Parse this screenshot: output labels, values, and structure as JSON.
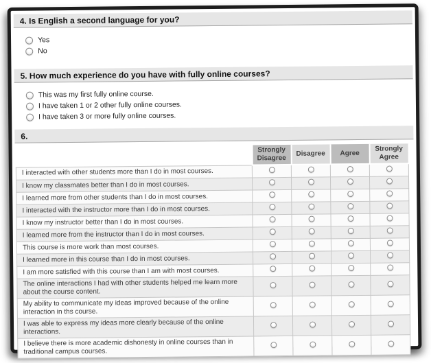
{
  "questions": [
    {
      "id": "q4",
      "title": "4. Is English a second language for you?",
      "options": [
        "Yes",
        "No"
      ],
      "selected": null
    },
    {
      "id": "q5",
      "title": "5. How much experience do you have with fully online courses?",
      "options": [
        "This was my first fully online course.",
        "I have taken 1 or 2 other fully online courses.",
        "I have taken 3 or more fully online courses."
      ],
      "selected": null
    },
    {
      "id": "q6",
      "title": "6.",
      "table": {
        "columns": [
          "Strongly Disagree",
          "Disagree",
          "Agree",
          "Strongly Agree"
        ],
        "rows": [
          "I interacted with other students more than I do in most courses.",
          "I know my classmates better than I do in most courses.",
          "I learned more from other students than I do in most courses.",
          "I interacted with the instructor more than I do in most courses.",
          "I know my instructor better than I do in most courses.",
          "I learned more from the instructor than I do in most courses.",
          "This course is more work than most courses.",
          "I learned more in this course than I do in most courses.",
          "I am more satisfied with this course than I am with most courses.",
          "The online interactions I had with other students helped me learn more about the course content.",
          "My ability to communicate my ideas improved because of the online interaction in ths course.",
          "I was able to express my ideas more clearly because of the online interactions.",
          "I believe there is more academic dishonesty in online courses than in traditional campus courses."
        ],
        "selected": []
      }
    }
  ],
  "colors": {
    "question_bar_bg": "#e6e6e6",
    "header_col_dark": "#bcbcbc",
    "header_col_light": "#dcdcdc",
    "row_alt_bg": "#ececec",
    "frame_border": "#1d1d1d"
  }
}
